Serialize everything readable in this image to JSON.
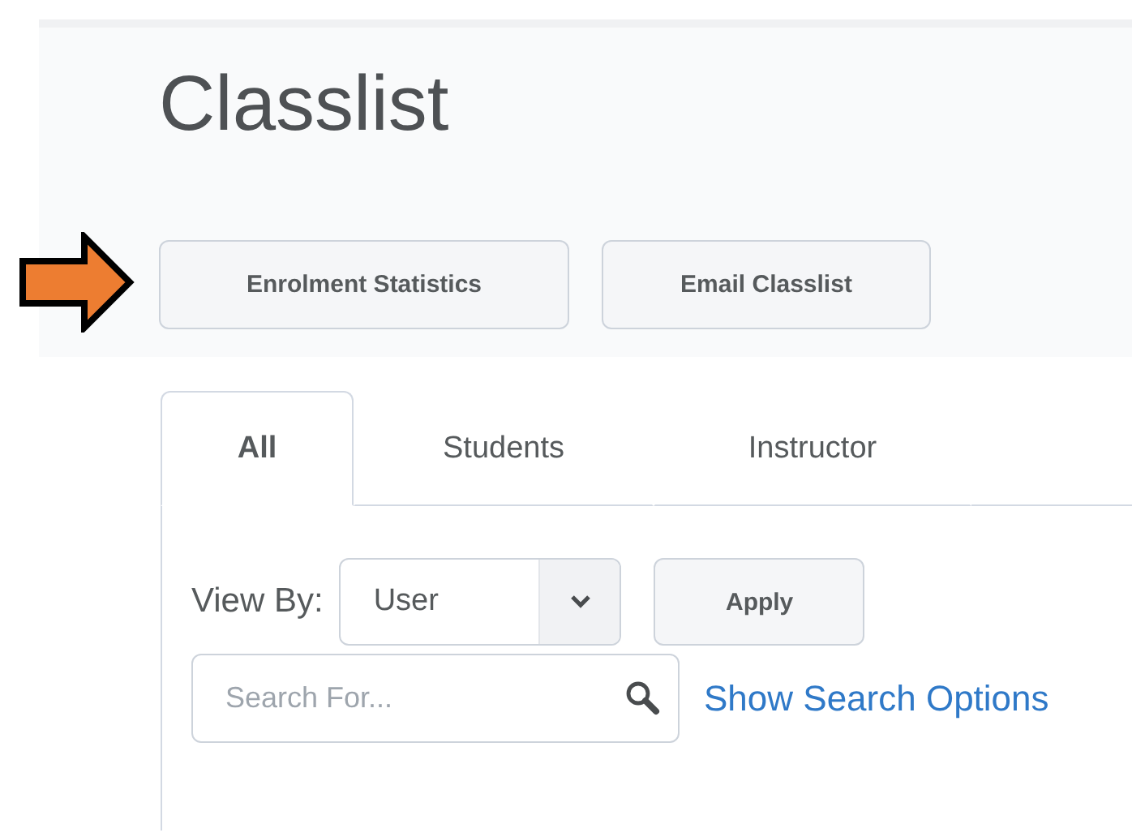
{
  "page": {
    "title": "Classlist"
  },
  "actions": [
    {
      "label": "Enrolment Statistics",
      "highlighted": true
    },
    {
      "label": "Email Classlist",
      "highlighted": false
    }
  ],
  "tabs": [
    {
      "label": "All",
      "selected": true
    },
    {
      "label": "Students",
      "selected": false
    },
    {
      "label": "Instructor",
      "selected": false
    }
  ],
  "view_by": {
    "label": "View By:",
    "value": "User",
    "apply": "Apply"
  },
  "search": {
    "placeholder": "Search For...",
    "link": "Show Search Options"
  }
}
